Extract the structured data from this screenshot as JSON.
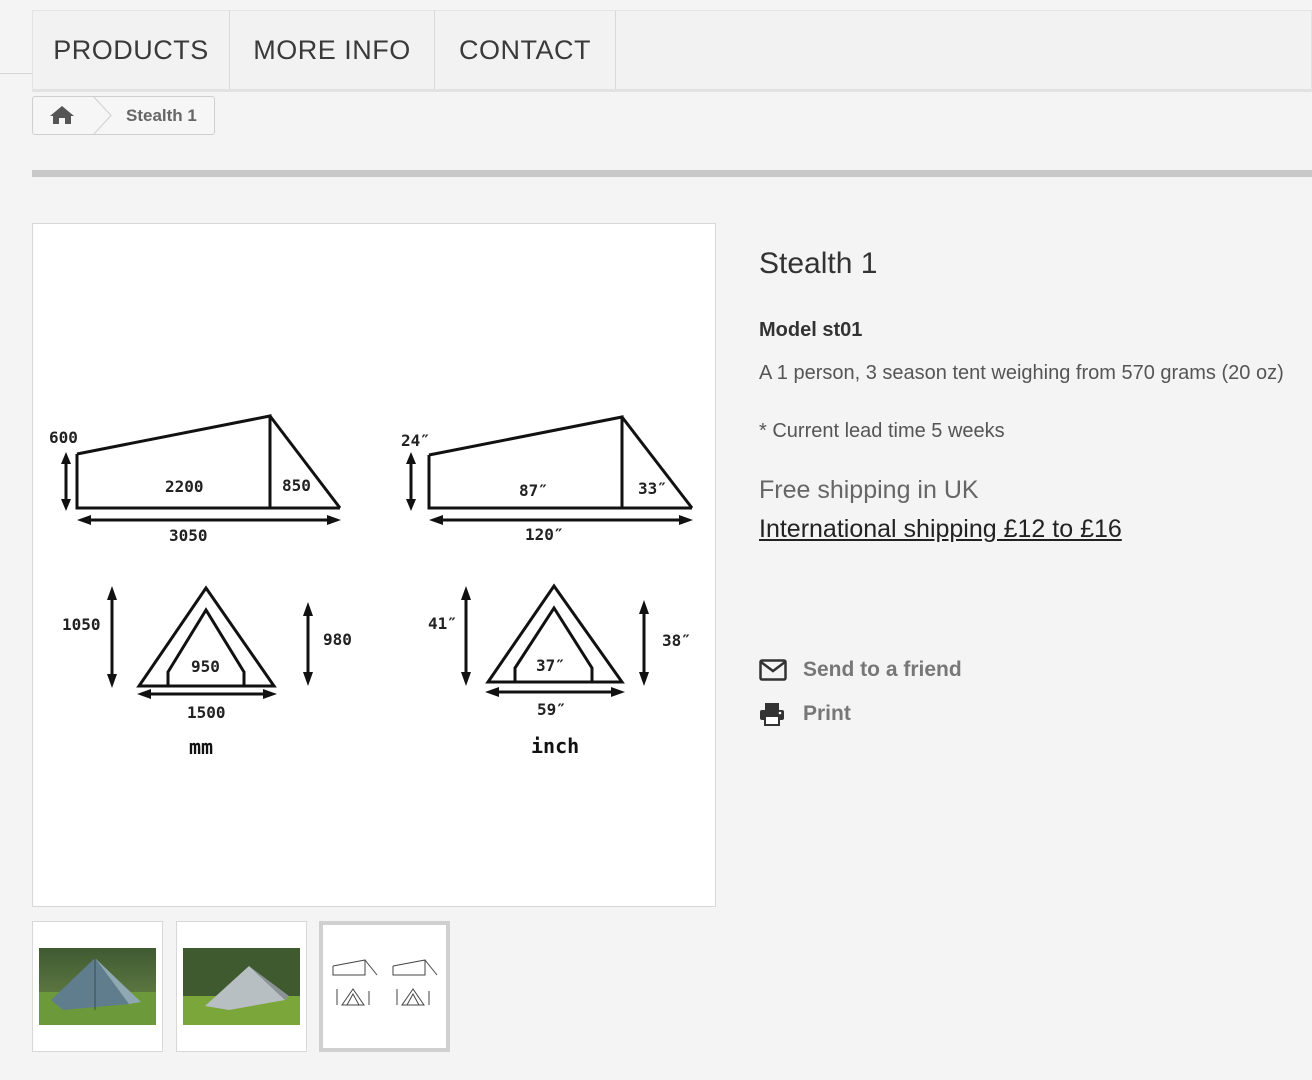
{
  "nav": {
    "items": [
      {
        "label": "PRODUCTS"
      },
      {
        "label": "MORE INFO"
      },
      {
        "label": "CONTACT"
      }
    ]
  },
  "breadcrumb": {
    "home_icon": "home-icon",
    "current": "Stealth 1"
  },
  "gallery": {
    "main_image": {
      "mm_labels": {
        "height": "600",
        "inner_length": "2200",
        "vestibule": "850",
        "total_length": "3050",
        "front_height": "1050",
        "inner_width": "950",
        "inner_height": "980",
        "base_width": "1500",
        "unit": "mm"
      },
      "inch_labels": {
        "height": "24″",
        "inner_length": "87″",
        "vestibule": "33″",
        "total_length": "120″",
        "front_height": "41″",
        "inner_width": "37″",
        "inner_height": "38″",
        "base_width": "59″",
        "unit": "inch"
      }
    },
    "thumbnails": [
      {
        "id": "tent-photo-1",
        "selected": false
      },
      {
        "id": "tent-photo-2",
        "selected": false
      },
      {
        "id": "dimensions-diagram",
        "selected": true
      }
    ]
  },
  "product": {
    "title": "Stealth 1",
    "model": "Model st01",
    "description": "A 1 person, 3 season tent weighing from 570 grams (20 oz)",
    "lead_time": "* Current lead time 5 weeks",
    "shipping_uk": "Free shipping in UK",
    "shipping_international": "International shipping £12 to £16"
  },
  "actions": [
    {
      "label": "Send to a friend",
      "icon": "envelope-icon"
    },
    {
      "label": "Print",
      "icon": "printer-icon"
    }
  ],
  "colors": {
    "background": "#f4f4f4",
    "nav_text": "#3a3a3a",
    "link": "#222222"
  }
}
